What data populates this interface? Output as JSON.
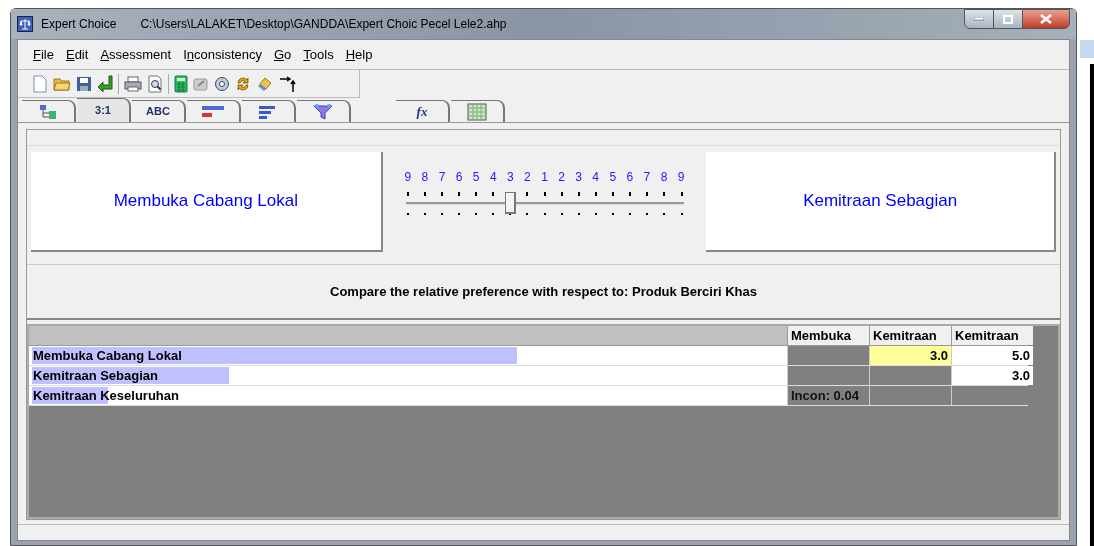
{
  "window": {
    "app": "Expert Choice",
    "path": "C:\\Users\\LALAKET\\Desktop\\GANDDA\\Expert Choic Pecel Lele2.ahp"
  },
  "menu": [
    {
      "key": "F",
      "rest": "ile"
    },
    {
      "key": "E",
      "rest": "dit"
    },
    {
      "key": "A",
      "rest": "ssessment"
    },
    {
      "pre": "I",
      "key": "n",
      "rest": "consistency"
    },
    {
      "key": "G",
      "rest": "o"
    },
    {
      "key": "T",
      "rest": "ools"
    },
    {
      "key": "H",
      "rest": "elp"
    }
  ],
  "tabs": [
    {
      "kind": "icon",
      "selected": false
    },
    {
      "kind": "text",
      "label": "3:1",
      "selected": true
    },
    {
      "kind": "text",
      "label": "ABC",
      "selected": false
    },
    {
      "kind": "icon",
      "selected": false
    },
    {
      "kind": "icon",
      "selected": false
    },
    {
      "kind": "icon",
      "selected": false
    },
    {
      "kind": "gap"
    },
    {
      "kind": "formula",
      "label": "fx",
      "selected": false
    },
    {
      "kind": "icon",
      "selected": false
    }
  ],
  "comparison": {
    "left": "Membuka Cabang Lokal",
    "right": "Kemitraan Sebagian",
    "scale": [
      "9",
      "8",
      "7",
      "6",
      "5",
      "4",
      "3",
      "2",
      "1",
      "2",
      "3",
      "4",
      "5",
      "6",
      "7",
      "8",
      "9"
    ],
    "slider": {
      "level": 0.375
    }
  },
  "question": "Compare the relative preference with respect to: Produk Berciri Khas",
  "matrix": {
    "columns": [
      "Membuka",
      "Kemitraan",
      "Kemitraan"
    ],
    "rows": [
      {
        "name": "Membuka Cabang Lokal",
        "level": 0.64,
        "cells": [
          {
            "kind": "blank"
          },
          {
            "kind": "value",
            "text": "3.0",
            "selected": true
          },
          {
            "kind": "value",
            "text": "5.0",
            "selected": false
          }
        ]
      },
      {
        "name": "Kemitraan Sebagian",
        "level": 0.26,
        "cells": [
          {
            "kind": "blank"
          },
          {
            "kind": "blank"
          },
          {
            "kind": "value",
            "text": "3.0",
            "selected": false
          }
        ]
      },
      {
        "name": "Kemitraan Keseluruhan",
        "level": 0.1,
        "cells": [
          {
            "kind": "incon",
            "text": "Incon: 0.04"
          },
          {
            "kind": "blank"
          },
          {
            "kind": "blank"
          }
        ]
      }
    ]
  }
}
